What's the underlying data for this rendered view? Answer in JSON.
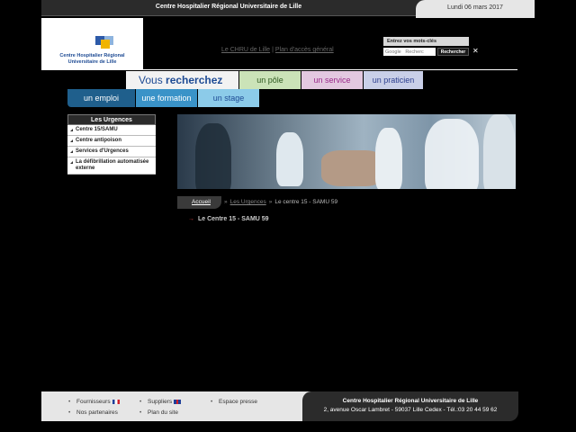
{
  "header": {
    "site_title": "Centre Hospitalier Régional Universitaire de Lille",
    "date": "Lundi 06 mars 2017",
    "logo_text_line1": "Centre Hospitalier Régional",
    "logo_text_line2": "Universitaire de Lille",
    "link_chru": "Le CHRU de Lille",
    "link_sep": "|",
    "link_plan": "Plan d'accès général"
  },
  "search": {
    "label": "Entrez vos mots-clés",
    "placeholder": "Google   Recherc",
    "button": "Rechercher",
    "close": "✕"
  },
  "nav": {
    "vous": "Vous ",
    "recherchez": "recherchez",
    "pole": "un pôle",
    "service": "un service",
    "praticien": "un praticien",
    "emploi": "un emploi",
    "formation": "une formation",
    "stage": "un stage"
  },
  "sidebar": {
    "title": "Les Urgences",
    "items": [
      {
        "label": "Centre 15/SAMU"
      },
      {
        "label": "Centre antipoison"
      },
      {
        "label": "Services d'Urgences"
      },
      {
        "label": "La défibrillation automatisée externe"
      }
    ]
  },
  "breadcrumb": {
    "home": "Accueil",
    "sep": "»",
    "section": "Les Urgences",
    "current": "Le centre 15 - SAMU 59"
  },
  "content": {
    "arrow": "→",
    "link": "Le Centre 15 - SAMU 59"
  },
  "footer": {
    "fournisseurs": "Fournisseurs",
    "suppliers": "Suppliers",
    "espace_presse": "Espace presse",
    "partenaires": "Nos partenaires",
    "plan_site": "Plan du site",
    "org_name": "Centre Hospitalier Régional Universitaire de Lille",
    "address": "2, avenue Oscar Lambret - 59037 Lille Cedex - Tél.:03 20 44 59 62"
  },
  "colors": {
    "brand_blue": "#1e4b94",
    "pole_green": "#cbe3b8",
    "service_pink": "#e3c8e0",
    "praticien_lilac": "#c9cfe8",
    "emploi_blue": "#1f5f8c",
    "formation_blue": "#3a93c8",
    "stage_blue": "#8ccbe9"
  }
}
